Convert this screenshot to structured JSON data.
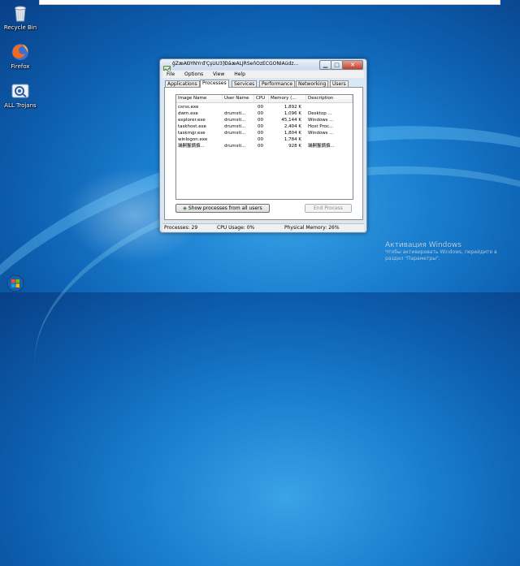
{
  "desktop": {
    "icons": [
      {
        "label": "Recycle Bin",
        "icon": "recycle-bin-icon"
      },
      {
        "label": "Firefox",
        "icon": "firefox-icon"
      },
      {
        "label": "ALL Trojans",
        "icon": "trojans-icon"
      }
    ],
    "activation": {
      "title": "Активация Windows",
      "line1": "Чтобы активировать Windows, перейдите в",
      "line2": "раздел \"Параметры\"."
    }
  },
  "taskmgr": {
    "title": "ĝŽæÃÐŸÑÝrđ'ÇşÜÜ3]ÐåæÃLJRŠeňÖzÉCGÖÑÌÃüdz...",
    "menu": [
      "File",
      "Options",
      "View",
      "Help"
    ],
    "tabs": [
      "Applications",
      "Processes",
      "Services",
      "Performance",
      "Networking",
      "Users"
    ],
    "active_tab": "Processes",
    "columns": [
      "Image Name",
      "User Name",
      "CPU",
      "Memory (...",
      "Description"
    ],
    "rows": [
      {
        "name": "csrss.exe",
        "user": "",
        "cpu": "00",
        "mem": "1,892 K",
        "desc": ""
      },
      {
        "name": "dwm.exe",
        "user": "drumsti...",
        "cpu": "00",
        "mem": "1,096 K",
        "desc": "Desktop ..."
      },
      {
        "name": "explorer.exe",
        "user": "drumsti...",
        "cpu": "00",
        "mem": "45,144 K",
        "desc": "Windows ..."
      },
      {
        "name": "taskhost.exe",
        "user": "drumsti...",
        "cpu": "00",
        "mem": "2,404 K",
        "desc": "Host Proc..."
      },
      {
        "name": "taskmgr.exe",
        "user": "drumsti...",
        "cpu": "00",
        "mem": "1,804 K",
        "desc": "Windows ..."
      },
      {
        "name": "winlogon.exe",
        "user": "",
        "cpu": "00",
        "mem": "1,784 K",
        "desc": ""
      },
      {
        "name": "璣嗣鬣鏑撰...",
        "user": "drumsti...",
        "cpu": "00",
        "mem": "928 K",
        "desc": "璣嗣鬣鏑撰..."
      }
    ],
    "show_all_button": "Show processes from all users",
    "end_process_button": "End Process",
    "status": {
      "processes": "Processes: 29",
      "cpu": "CPU Usage: 0%",
      "memory": "Physical Memory: 26%"
    }
  }
}
